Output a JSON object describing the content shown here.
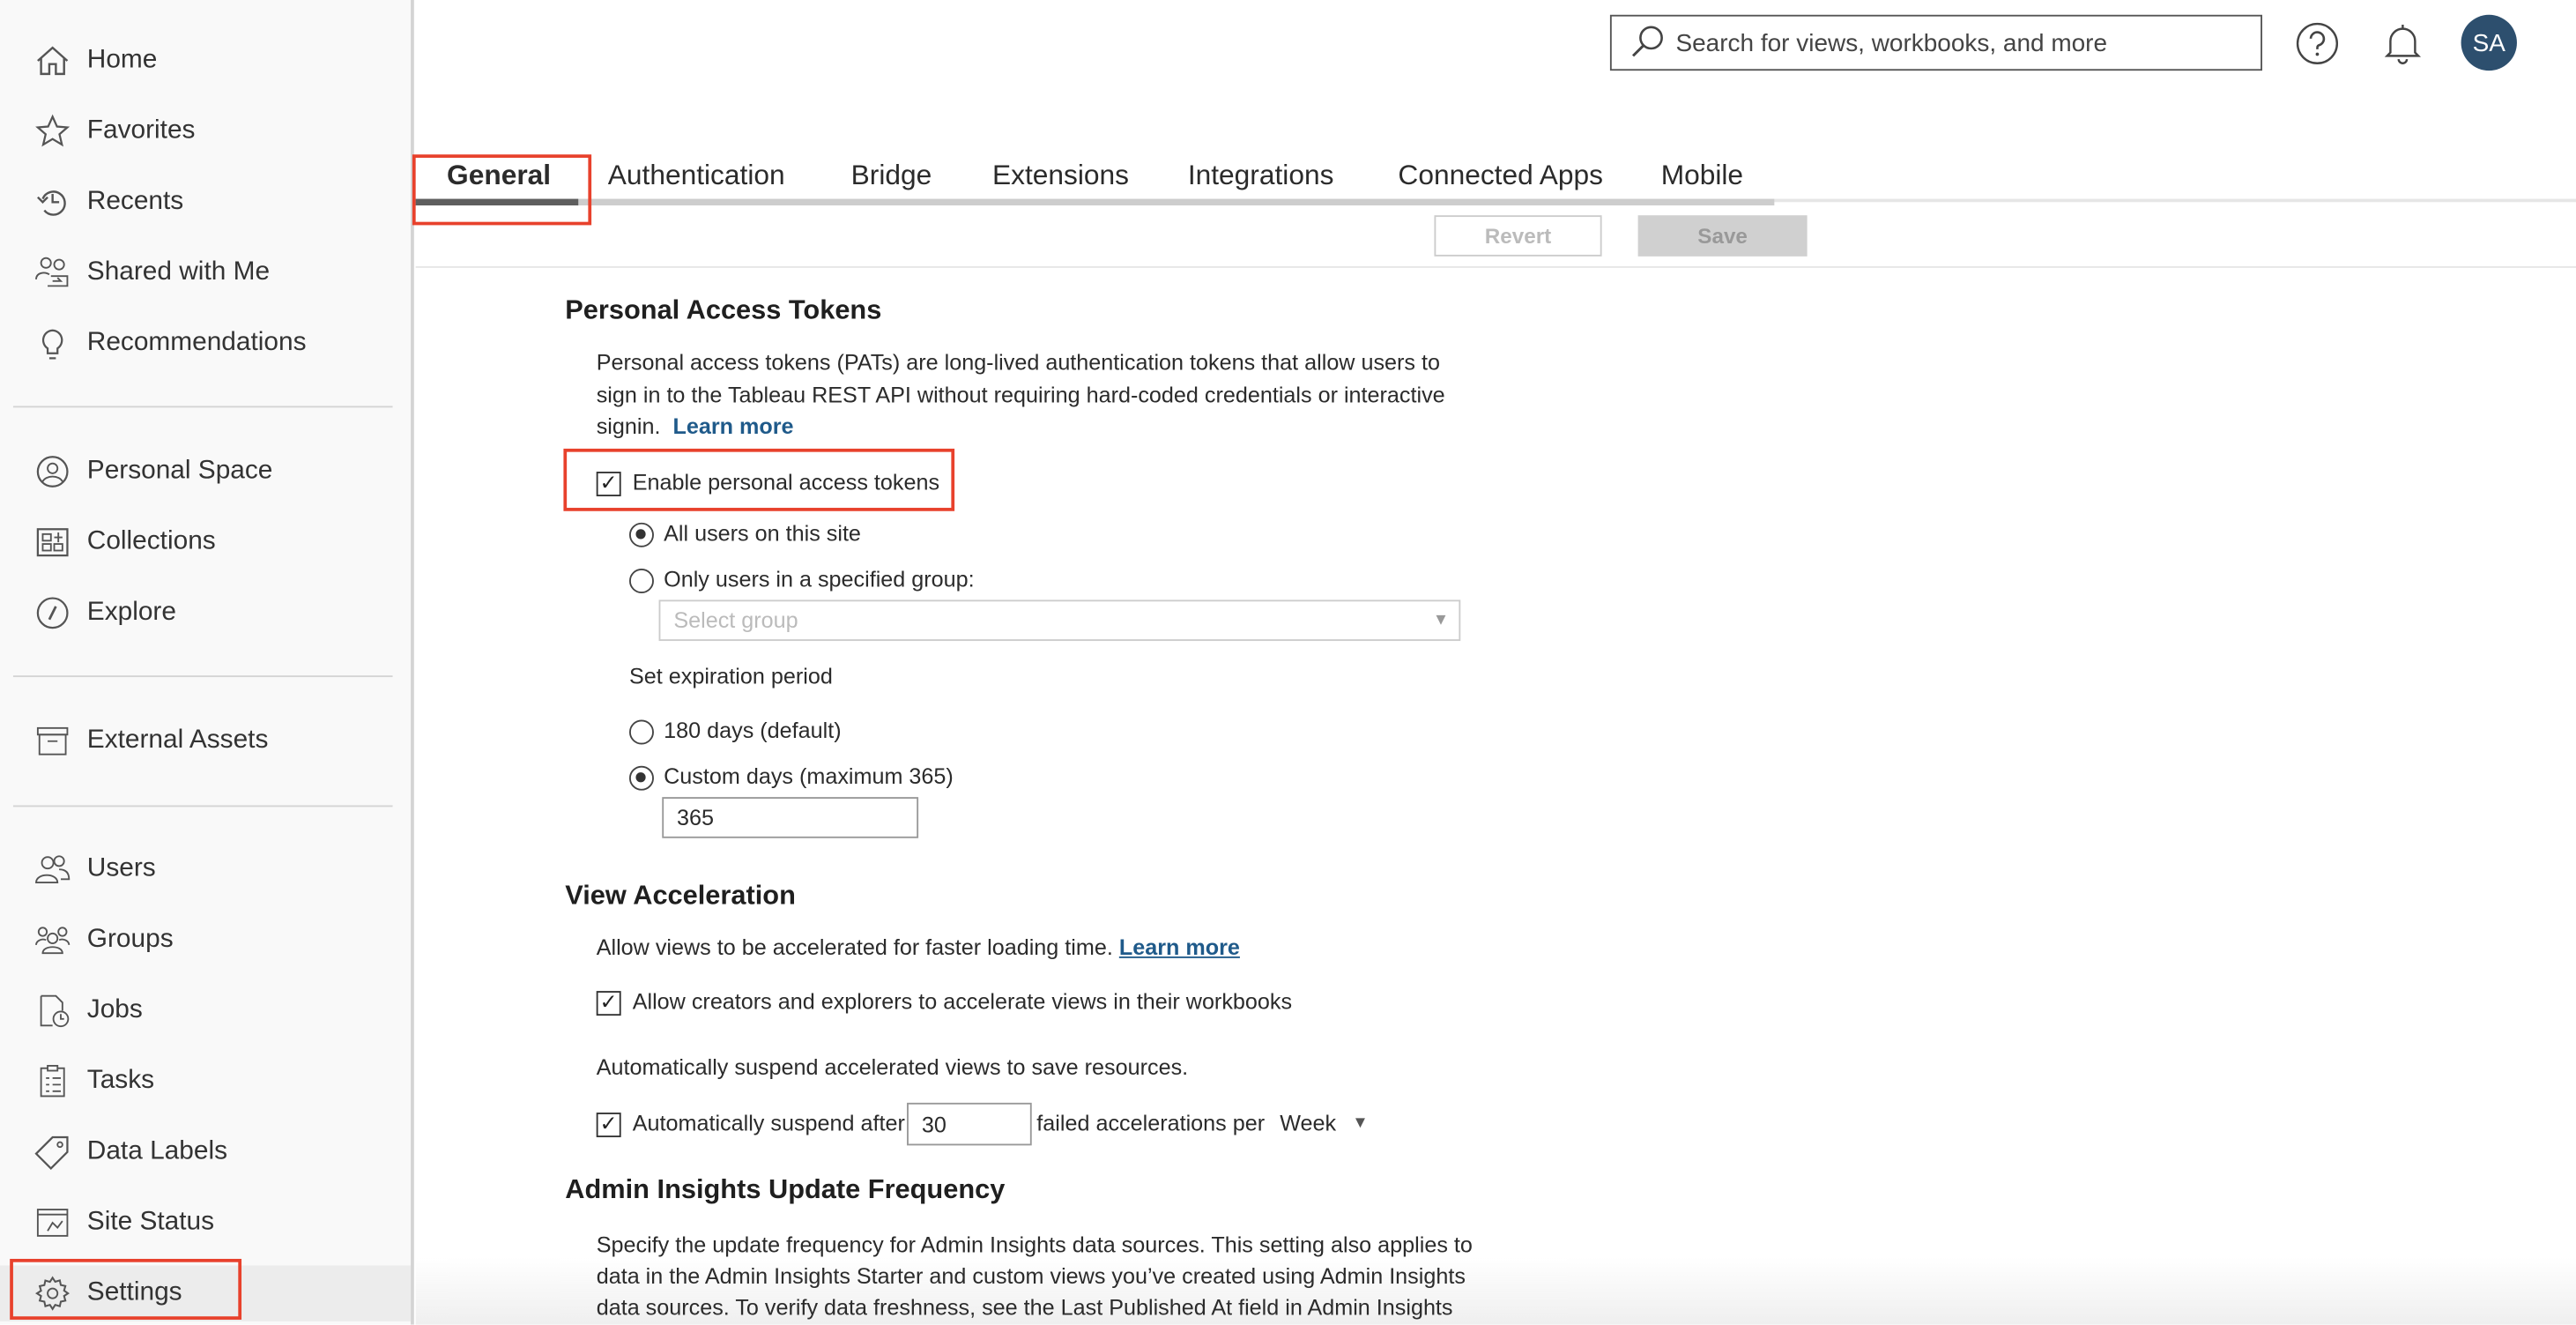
{
  "sidebar": {
    "groups": [
      [
        {
          "label": "Home",
          "icon": "home-icon"
        },
        {
          "label": "Favorites",
          "icon": "star-icon"
        },
        {
          "label": "Recents",
          "icon": "history-icon"
        },
        {
          "label": "Shared with Me",
          "icon": "shared-users-icon"
        },
        {
          "label": "Recommendations",
          "icon": "lightbulb-icon"
        }
      ],
      [
        {
          "label": "Personal Space",
          "icon": "user-circle-icon"
        },
        {
          "label": "Collections",
          "icon": "collections-icon"
        },
        {
          "label": "Explore",
          "icon": "compass-icon"
        }
      ],
      [
        {
          "label": "External Assets",
          "icon": "archive-icon"
        }
      ],
      [
        {
          "label": "Users",
          "icon": "users-icon"
        },
        {
          "label": "Groups",
          "icon": "groups-icon"
        },
        {
          "label": "Jobs",
          "icon": "jobs-icon"
        },
        {
          "label": "Tasks",
          "icon": "clipboard-icon"
        },
        {
          "label": "Data Labels",
          "icon": "tag-icon"
        },
        {
          "label": "Site Status",
          "icon": "site-status-icon"
        },
        {
          "label": "Settings",
          "icon": "gear-icon",
          "selected": true
        }
      ]
    ]
  },
  "header": {
    "search_placeholder": "Search for views, workbooks, and more",
    "avatar_initials": "SA",
    "avatar_color": "#2d4f6e"
  },
  "tabs": [
    {
      "label": "General",
      "active": true
    },
    {
      "label": "Authentication"
    },
    {
      "label": "Bridge"
    },
    {
      "label": "Extensions"
    },
    {
      "label": "Integrations"
    },
    {
      "label": "Connected Apps"
    },
    {
      "label": "Mobile"
    }
  ],
  "toolbar": {
    "revert_label": "Revert",
    "save_label": "Save"
  },
  "pat": {
    "title": "Personal Access Tokens",
    "desc_lines": [
      "Personal access tokens (PATs) are long-lived authentication tokens that allow users to",
      "sign in to the Tableau REST API without requiring hard-coded credentials or interactive",
      "signin."
    ],
    "learn_more": "Learn more",
    "enable_label": "Enable personal access tokens",
    "enable_checked": true,
    "all_users": "All users on this site",
    "only_group": "Only users in a specified group:",
    "select_group_placeholder": "Select group",
    "expiration_label": "Set expiration period",
    "default_days": "180 days (default)",
    "custom_days": "Custom days (maximum 365)",
    "custom_value": "365"
  },
  "view_accel": {
    "title": "View Acceleration",
    "desc": "Allow views to be accelerated for faster loading time.",
    "learn_more": "Learn more",
    "allow_label": "Allow creators and explorers to accelerate views in their workbooks",
    "allow_checked": true,
    "suspend_desc": "Automatically suspend accelerated views to save resources.",
    "suspend_before": "Automatically suspend after",
    "suspend_value": "30",
    "suspend_after": "failed accelerations per",
    "period": "Week",
    "suspend_checked": true
  },
  "admin_insights": {
    "title": "Admin Insights Update Frequency",
    "desc_lines": [
      "Specify the update frequency for Admin Insights data sources. This setting also applies to",
      "data in the Admin Insights Starter and custom views you’ve created using Admin Insights",
      "data sources. To verify data freshness, see the Last Published At field in Admin Insights"
    ]
  },
  "colors": {
    "highlight_box": "#e8412c",
    "link": "#1f5a8a"
  }
}
